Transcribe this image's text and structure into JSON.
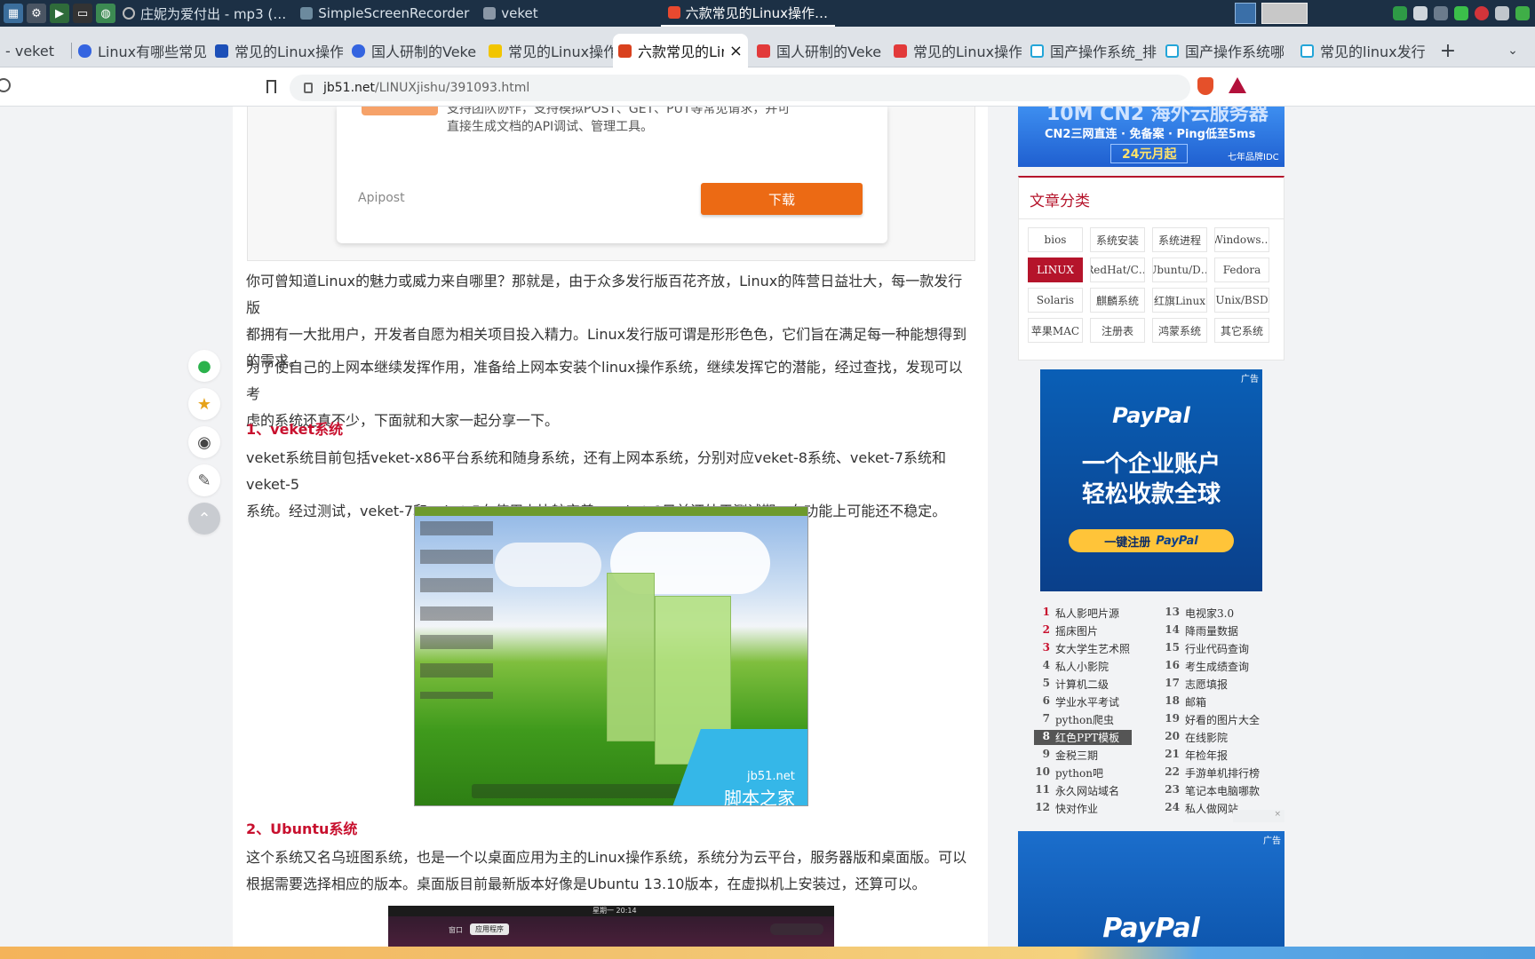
{
  "taskbar": {
    "tasks": [
      {
        "label": "庄妮为爱付出 - mp3 (…"
      },
      {
        "label": "SimpleScreenRecorder"
      },
      {
        "label": "veket"
      },
      {
        "label": "六款常见的Linux操作…"
      }
    ]
  },
  "tabs": [
    {
      "label": "- veket"
    },
    {
      "label": "Linux有哪些常见"
    },
    {
      "label": "常见的Linux操作"
    },
    {
      "label": "国人研制的Veke"
    },
    {
      "label": "常见的Linux操作"
    },
    {
      "label": "六款常见的Lin"
    },
    {
      "label": "国人研制的Veke"
    },
    {
      "label": "常见的Linux操作"
    },
    {
      "label": "国产操作系统_排"
    },
    {
      "label": "国产操作系统哪"
    },
    {
      "label": "常见的linux发行"
    }
  ],
  "tab_new": "+",
  "tab_close": "×",
  "url": {
    "host": "jb51.net",
    "path": "/LINUXjishu/391093.html"
  },
  "ad_card": {
    "line1": "支持团队协作，支持模拟POST、GET、PUT等常见请求，并可",
    "line2": "直接生成文档的API调试、管理工具。",
    "brand": "Apipost",
    "download": "下载"
  },
  "article": {
    "p1_l1": "你可曾知道Linux的魅力或威力来自哪里？那就是，由于众多发行版百花齐放，Linux的阵营日益壮大，每一款发行版",
    "p1_l2": "都拥有一大批用户，开发者自愿为相关项目投入精力。Linux发行版可谓是形形色色，它们旨在满足每一种能想得到",
    "p1_l3": "的需求。",
    "p2_l1": "为了使自己的上网本继续发挥作用，准备给上网本安装个linux操作系统，继续发挥它的潜能，经过查找，发现可以考",
    "p2_l2": "虑的系统还真不少，下面就和大家一起分享一下。",
    "h1": "1、veket系统",
    "p3_l1": "veket系统目前包括veket-x86平台系统和随身系统，还有上网本系统，分别对应veket-8系统、veket-7系统和veket-5",
    "p3_l2": "系统。经过测试，veket-7和veket-5在使用上比较完善。veket-8目前还处于测试期，在功能上可能还不稳定。",
    "img_wm1": "jb51.net",
    "img_wm2": "脚本之家",
    "h2": "2、Ubuntu系统",
    "p4_l1": "这个系统又名乌班图系统，也是一个以桌面应用为主的Linux操作系统，系统分为云平台，服务器版和桌面版。可以",
    "p4_l2": "根据需要选择相应的版本。桌面版目前最新版本好像是Ubuntu 13.10版本，在虚拟机上安装过，还算可以。",
    "img2_bar": "星期一 20:14",
    "img2_btn1": "窗口",
    "img2_btn2": "应用程序"
  },
  "sidebar": {
    "banner_big": "10M CN2 海外云服务器",
    "banner_sub": "CN2三网直连 · 免备案 · Ping低至5ms",
    "banner_price": "24元月起",
    "banner_brand": "七年品牌IDC",
    "cat_title": "文章分类",
    "categories": [
      "bios",
      "系统安装",
      "系统进程",
      "Windows…",
      "LINUX",
      "RedHat/C…",
      "Ubuntu/D…",
      "Fedora",
      "Solaris",
      "麒麟系统",
      "红旗Linux",
      "Unix/BSD",
      "苹果MAC",
      "注册表",
      "鸿蒙系统",
      "其它系统"
    ],
    "ad_label": "广告",
    "paypal_brand": "PayPal",
    "paypal_l1": "一个企业账户",
    "paypal_l2": "轻松收款全球",
    "paypal_btn": "一键注册",
    "hot_left": [
      {
        "n": "1",
        "t": "私人影吧片源"
      },
      {
        "n": "2",
        "t": "摇床图片"
      },
      {
        "n": "3",
        "t": "女大学生艺术照"
      },
      {
        "n": "4",
        "t": "私人小影院"
      },
      {
        "n": "5",
        "t": "计算机二级"
      },
      {
        "n": "6",
        "t": "学业水平考试"
      },
      {
        "n": "7",
        "t": "python爬虫"
      },
      {
        "n": "8",
        "t": "红色PPT模板"
      },
      {
        "n": "9",
        "t": "金税三期"
      },
      {
        "n": "10",
        "t": "python吧"
      },
      {
        "n": "11",
        "t": "永久网站域名"
      },
      {
        "n": "12",
        "t": "快对作业"
      }
    ],
    "hot_right": [
      {
        "n": "13",
        "t": "电视家3.0"
      },
      {
        "n": "14",
        "t": "降雨量数据"
      },
      {
        "n": "15",
        "t": "行业代码查询"
      },
      {
        "n": "16",
        "t": "考生成绩查询"
      },
      {
        "n": "17",
        "t": "志愿填报"
      },
      {
        "n": "18",
        "t": "邮箱"
      },
      {
        "n": "19",
        "t": "好看的图片大全"
      },
      {
        "n": "20",
        "t": "在线影院"
      },
      {
        "n": "21",
        "t": "年检年报"
      },
      {
        "n": "22",
        "t": "手游单机排行榜"
      },
      {
        "n": "23",
        "t": "笔记本电脑哪款"
      },
      {
        "n": "24",
        "t": "私人做网站"
      }
    ]
  }
}
